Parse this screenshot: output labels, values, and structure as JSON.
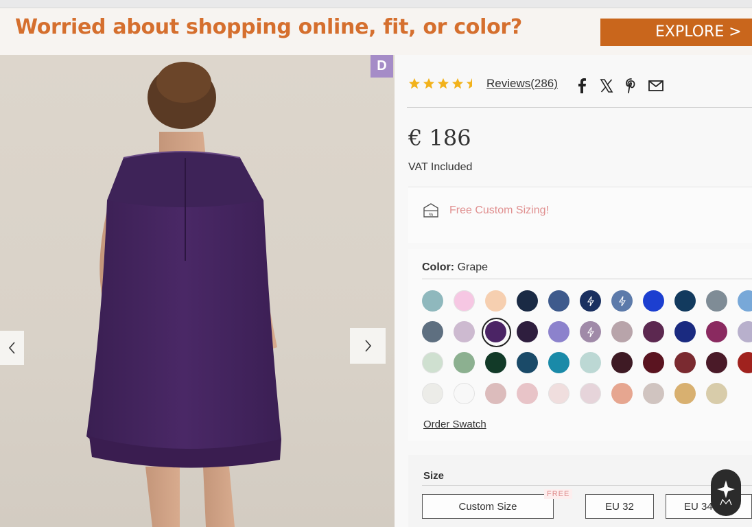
{
  "banner": {
    "headline": "Worried about shopping online, fit, or color?",
    "cta_label": "EXPLORE >",
    "accent_color": "#c9661c"
  },
  "gallery": {
    "badge": "D",
    "prev_icon": "chevron-left-icon",
    "next_icon": "chevron-right-icon"
  },
  "product": {
    "rating": 4.5,
    "reviews_label": "Reviews(286)",
    "share_icons": [
      "facebook-icon",
      "x-icon",
      "pinterest-icon",
      "email-icon"
    ],
    "price": "€ 186",
    "vat": "VAT Included",
    "custom_sizing": "Free Custom Sizing!",
    "color_label": "Color:",
    "color_value": "Grape",
    "order_swatch": "Order Swatch",
    "size_label": "Size",
    "sizes": [
      "Custom Size",
      "EU 32",
      "EU 34"
    ],
    "free_tag": "FREE"
  },
  "swatches": [
    {
      "color": "#8fb8bd"
    },
    {
      "color": "#f6c7e3"
    },
    {
      "color": "#f6cfb0"
    },
    {
      "color": "#1a2a44"
    },
    {
      "color": "#3e5a8c"
    },
    {
      "color": "#1a3060",
      "icon": "bolt-icon"
    },
    {
      "color": "#5c7aaa",
      "icon": "bolt-icon"
    },
    {
      "color": "#1c3fd0"
    },
    {
      "color": "#123a5e"
    },
    {
      "color": "#7f8c96"
    },
    {
      "color": "#78a8d8"
    },
    {
      "color": "#5e6f80"
    },
    {
      "color": "#cdbad0"
    },
    {
      "color": "#4b2465",
      "selected": true
    },
    {
      "color": "#2e1e3e"
    },
    {
      "color": "#8c82cc"
    },
    {
      "color": "#a08aa8",
      "icon": "bolt-icon"
    },
    {
      "color": "#b8a4aa"
    },
    {
      "color": "#5c2850"
    },
    {
      "color": "#1a2a80"
    },
    {
      "color": "#8a2a60"
    },
    {
      "color": "#b8b0cc"
    },
    {
      "color": "#cfe0d0"
    },
    {
      "color": "#8cb090"
    },
    {
      "color": "#123a28"
    },
    {
      "color": "#1a4a68"
    },
    {
      "color": "#1a8aa8"
    },
    {
      "color": "#bcd8d4"
    },
    {
      "color": "#3e1a24"
    },
    {
      "color": "#5a1420"
    },
    {
      "color": "#7a2a30"
    },
    {
      "color": "#4a1a28"
    },
    {
      "color": "#a0221e"
    },
    {
      "color": "#ecece8"
    },
    {
      "color": "#f8f8f8"
    },
    {
      "color": "#dcbcbc"
    },
    {
      "color": "#e8c4c8"
    },
    {
      "color": "#f0dede"
    },
    {
      "color": "#e6d4da"
    },
    {
      "color": "#e6a690"
    },
    {
      "color": "#d0c4c0"
    },
    {
      "color": "#d8b070"
    },
    {
      "color": "#d8ccaa"
    }
  ]
}
